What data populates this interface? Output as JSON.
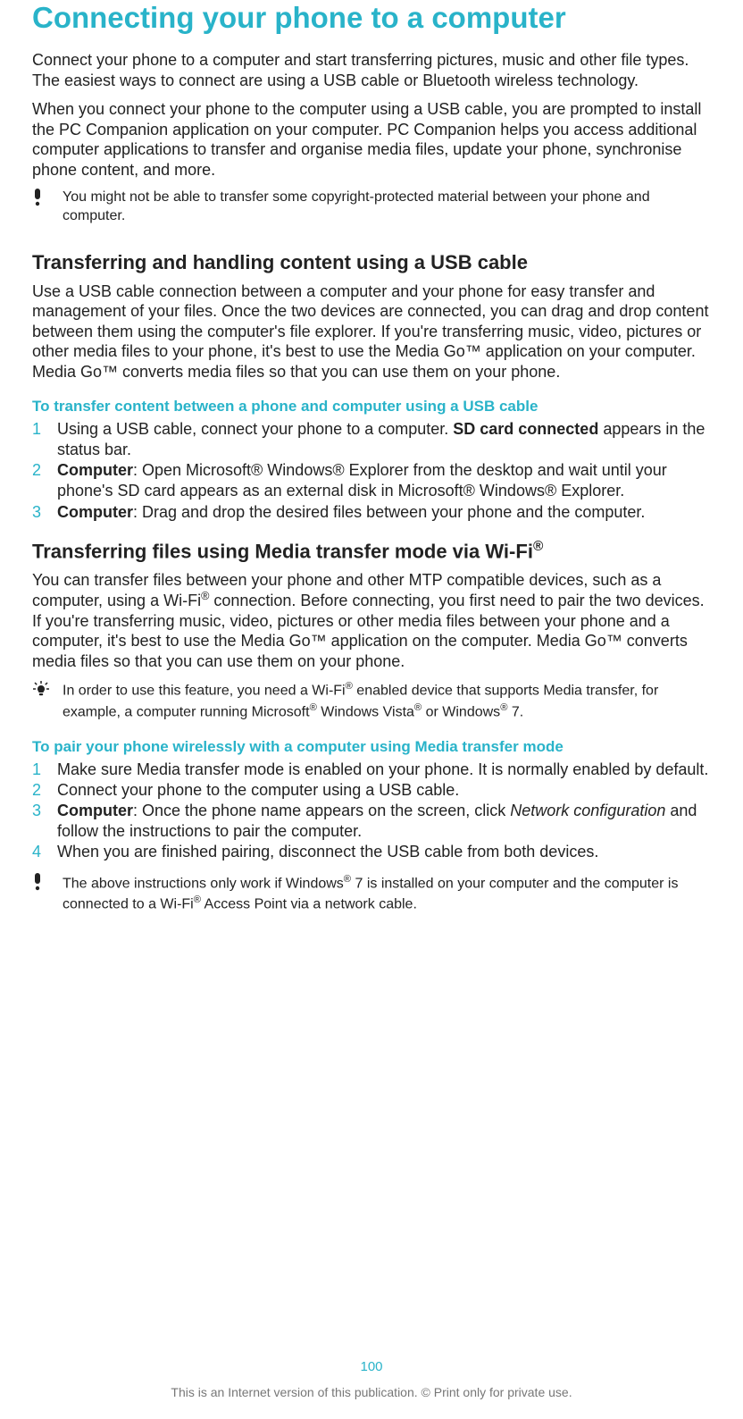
{
  "title": "Connecting your phone to a computer",
  "intro1": "Connect your phone to a computer and start transferring pictures, music and other file types. The easiest ways to connect are using a USB cable or Bluetooth wireless technology.",
  "intro2": "When you connect your phone to the computer using a USB cable, you are prompted to install the PC Companion application on your computer. PC Companion helps you access additional computer applications to transfer and organise media files, update your phone, synchronise phone content, and more.",
  "note_copyright": "You might not be able to transfer some copyright-protected material between your phone and computer.",
  "section_usb": {
    "heading": "Transferring and handling content using a USB cable",
    "body": "Use a USB cable connection between a computer and your phone for easy transfer and management of your files. Once the two devices are connected, you can drag and drop content between them using the computer's file explorer. If you're transferring music, video, pictures or other media files to your phone, it's best to use the Media Go™ application on your computer. Media Go™ converts media files so that you can use them on your phone.",
    "task_heading": "To transfer content between a phone and computer using a USB cable",
    "steps": {
      "s1_a": "Using a USB cable, connect your phone to a computer. ",
      "s1_b": "SD card connected",
      "s1_c": " appears in the status bar.",
      "s2_a": "Computer",
      "s2_b": ": Open Microsoft® Windows® Explorer from the desktop and wait until your phone's SD card appears as an external disk in Microsoft® Windows® Explorer.",
      "s3_a": "Computer",
      "s3_b": ": Drag and drop the desired files between your phone and the computer."
    }
  },
  "section_wifi": {
    "heading_a": "Transferring files using Media transfer mode via Wi-Fi",
    "heading_sup": "®",
    "body_a": "You can transfer files between your phone and other MTP compatible devices, such as a computer, using a Wi-Fi",
    "body_sup1": "®",
    "body_b": " connection. Before connecting, you first need to pair the two devices. If you're transferring music, video, pictures or other media files between your phone and a computer, it's best to use the Media Go™ application on the computer. Media Go™ converts media files so that you can use them on your phone.",
    "tip_a": "In order to use this feature, you need a Wi-Fi",
    "tip_sup1": "®",
    "tip_b": " enabled device that supports Media transfer, for example, a computer running Microsoft",
    "tip_sup2": "®",
    "tip_c": " Windows Vista",
    "tip_sup3": "®",
    "tip_d": " or Windows",
    "tip_sup4": "®",
    "tip_e": " 7.",
    "task_heading": "To pair your phone wirelessly with a computer using Media transfer mode",
    "steps": {
      "s1": "Make sure Media transfer mode is enabled on your phone. It is normally enabled by default.",
      "s2": "Connect your phone to the computer using a USB cable.",
      "s3_a": "Computer",
      "s3_b": ": Once the phone name appears on the screen, click ",
      "s3_c": "Network configuration",
      "s3_d": " and follow the instructions to pair the computer.",
      "s4": "When you are finished pairing, disconnect the USB cable from both devices."
    },
    "note_a": "The above instructions only work if Windows",
    "note_sup1": "®",
    "note_b": " 7 is installed on your computer and the computer is connected to a Wi-Fi",
    "note_sup2": "®",
    "note_c": " Access Point via a network cable."
  },
  "page_number": "100",
  "footer_note": "This is an Internet version of this publication. © Print only for private use."
}
